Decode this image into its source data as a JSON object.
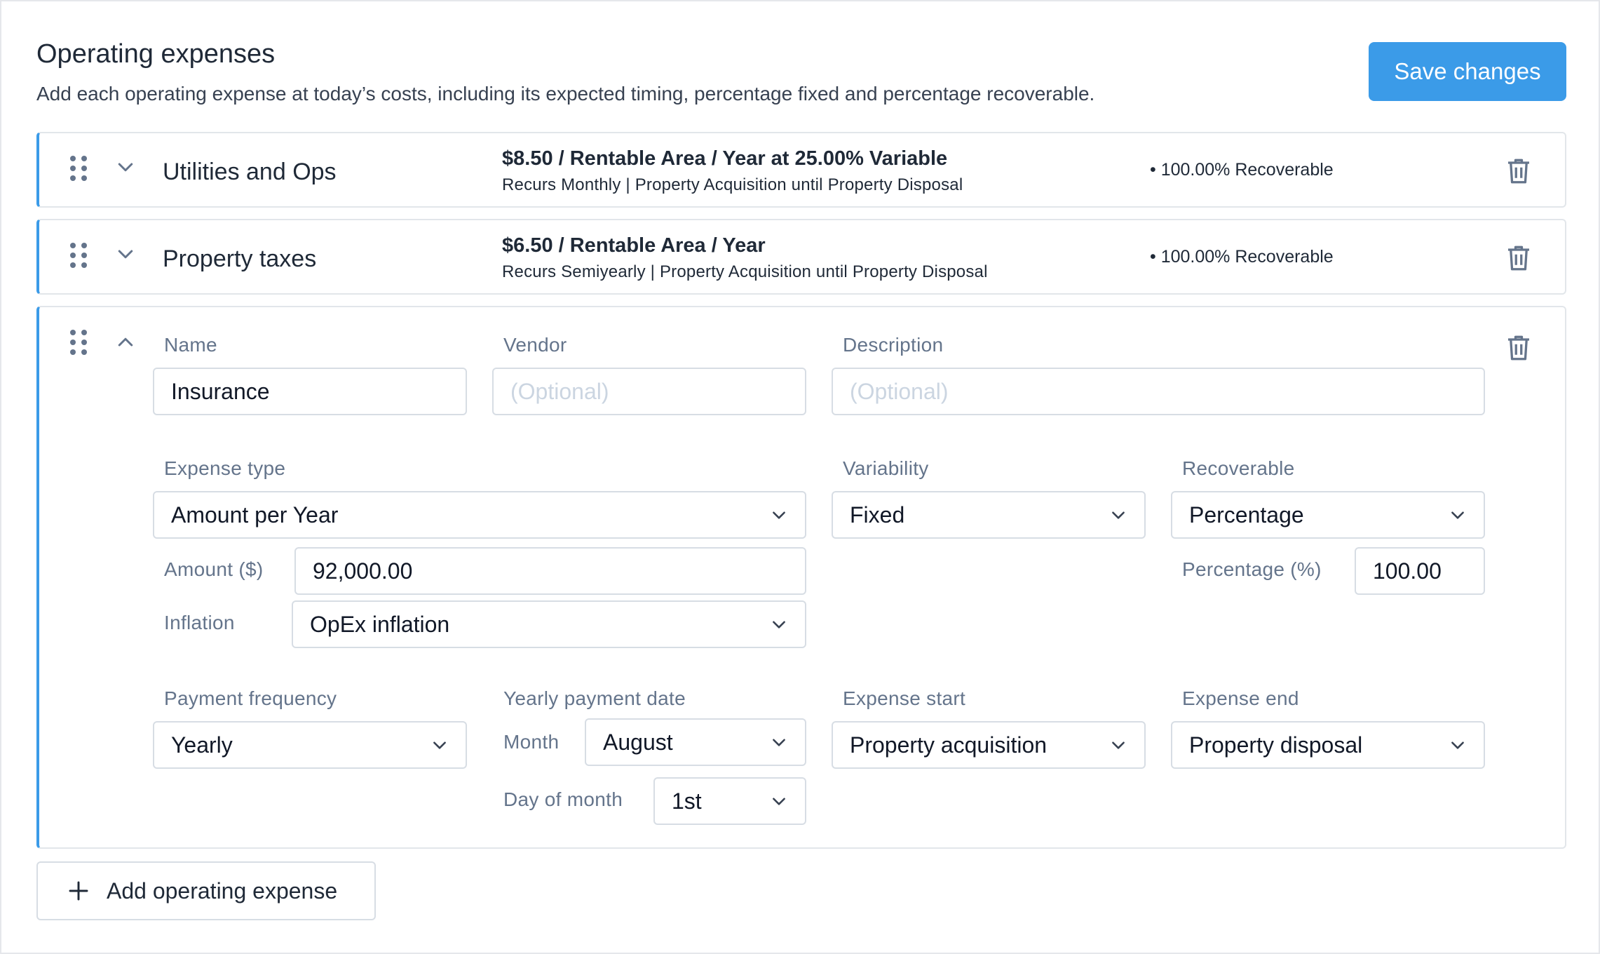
{
  "header": {
    "title": "Operating expenses",
    "subtitle": "Add each operating expense at today’s costs, including its expected timing, percentage fixed and percentage recoverable.",
    "save_label": "Save changes"
  },
  "expenses": [
    {
      "name": "Utilities and Ops",
      "summary": "$8.50 / Rentable Area / Year at 25.00% Variable",
      "detail": "Recurs Monthly | Property Acquisition until Property Disposal",
      "recoverable": "• 100.00% Recoverable"
    },
    {
      "name": "Property taxes",
      "summary": "$6.50 / Rentable Area / Year",
      "detail": "Recurs Semiyearly | Property Acquisition until Property Disposal",
      "recoverable": "• 100.00% Recoverable"
    }
  ],
  "form": {
    "name_label": "Name",
    "name_value": "Insurance",
    "vendor_label": "Vendor",
    "vendor_placeholder": "(Optional)",
    "description_label": "Description",
    "description_placeholder": "(Optional)",
    "expense_type_label": "Expense type",
    "expense_type_value": "Amount per Year",
    "variability_label": "Variability",
    "variability_value": "Fixed",
    "recoverable_label": "Recoverable",
    "recoverable_value": "Percentage",
    "amount_label": "Amount ($)",
    "amount_value": "92,000.00",
    "percentage_label": "Percentage (%)",
    "percentage_value": "100.00",
    "inflation_label": "Inflation",
    "inflation_value": "OpEx inflation",
    "payment_frequency_label": "Payment frequency",
    "payment_frequency_value": "Yearly",
    "yearly_payment_date_label": "Yearly payment date",
    "month_label": "Month",
    "month_value": "August",
    "day_label": "Day of month",
    "day_value": "1st",
    "expense_start_label": "Expense start",
    "expense_start_value": "Property acquisition",
    "expense_end_label": "Expense end",
    "expense_end_value": "Property disposal"
  },
  "add_label": "Add operating expense",
  "colors": {
    "accent": "#3b9be8",
    "label": "#64748b",
    "border": "#d7dde4"
  }
}
